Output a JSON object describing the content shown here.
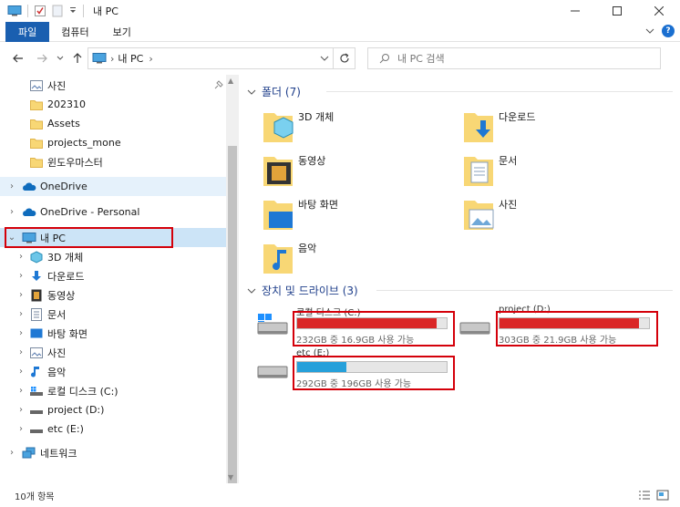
{
  "window": {
    "title": "내 PC"
  },
  "ribbon": {
    "tabs": [
      "파일",
      "컴퓨터",
      "보기"
    ],
    "help_label": "?"
  },
  "address": {
    "crumbs": [
      "내 PC"
    ]
  },
  "search": {
    "placeholder": "내 PC 검색"
  },
  "nav": {
    "items": [
      {
        "label": "사진",
        "icon": "pictures-icon"
      },
      {
        "label": "202310",
        "icon": "folder-icon"
      },
      {
        "label": "Assets",
        "icon": "folder-icon"
      },
      {
        "label": "projects_mone",
        "icon": "folder-icon"
      },
      {
        "label": "윈도우마스터",
        "icon": "folder-icon"
      },
      {
        "label": "OneDrive",
        "icon": "onedrive-icon"
      },
      {
        "label": "OneDrive - Personal",
        "icon": "onedrive-icon"
      },
      {
        "label": "내 PC",
        "icon": "pc-icon"
      },
      {
        "label": "3D 개체",
        "icon": "3d-objects-icon"
      },
      {
        "label": "다운로드",
        "icon": "download-icon"
      },
      {
        "label": "동영상",
        "icon": "video-icon"
      },
      {
        "label": "문서",
        "icon": "document-icon"
      },
      {
        "label": "바탕 화면",
        "icon": "desktop-icon"
      },
      {
        "label": "사진",
        "icon": "pictures-icon"
      },
      {
        "label": "음악",
        "icon": "music-icon"
      },
      {
        "label": "로컬 디스크 (C:)",
        "icon": "system-drive-icon"
      },
      {
        "label": "project (D:)",
        "icon": "drive-icon"
      },
      {
        "label": "etc (E:)",
        "icon": "drive-icon"
      },
      {
        "label": "네트워크",
        "icon": "network-icon"
      }
    ]
  },
  "folders": {
    "heading": "폴더 (7)",
    "items": [
      {
        "label": "3D 개체",
        "icon": "3d-objects-icon"
      },
      {
        "label": "다운로드",
        "icon": "download-icon"
      },
      {
        "label": "동영상",
        "icon": "video-icon"
      },
      {
        "label": "문서",
        "icon": "document-icon"
      },
      {
        "label": "바탕 화면",
        "icon": "desktop-icon"
      },
      {
        "label": "사진",
        "icon": "pictures-icon"
      },
      {
        "label": "음악",
        "icon": "music-icon"
      }
    ]
  },
  "drives": {
    "heading": "장치 및 드라이브 (3)",
    "items": [
      {
        "name": "로컬 디스크 (C:)",
        "info": "232GB 중 16.9GB 사용 가능",
        "used_fraction": 0.93,
        "color": "#da2626"
      },
      {
        "name": "project (D:)",
        "info": "303GB 중 21.9GB 사용 가능",
        "used_fraction": 0.93,
        "color": "#da2626"
      },
      {
        "name": "etc (E:)",
        "info": "292GB 중 196GB 사용 가능",
        "used_fraction": 0.33,
        "color": "#26a0da"
      }
    ]
  },
  "status": {
    "count": "10개 항목"
  },
  "colors": {
    "accent": "#1a5fb0",
    "selection": "#cce4f7",
    "highlight_box": "#d4000a",
    "folder_title": "#1e3e8a"
  }
}
